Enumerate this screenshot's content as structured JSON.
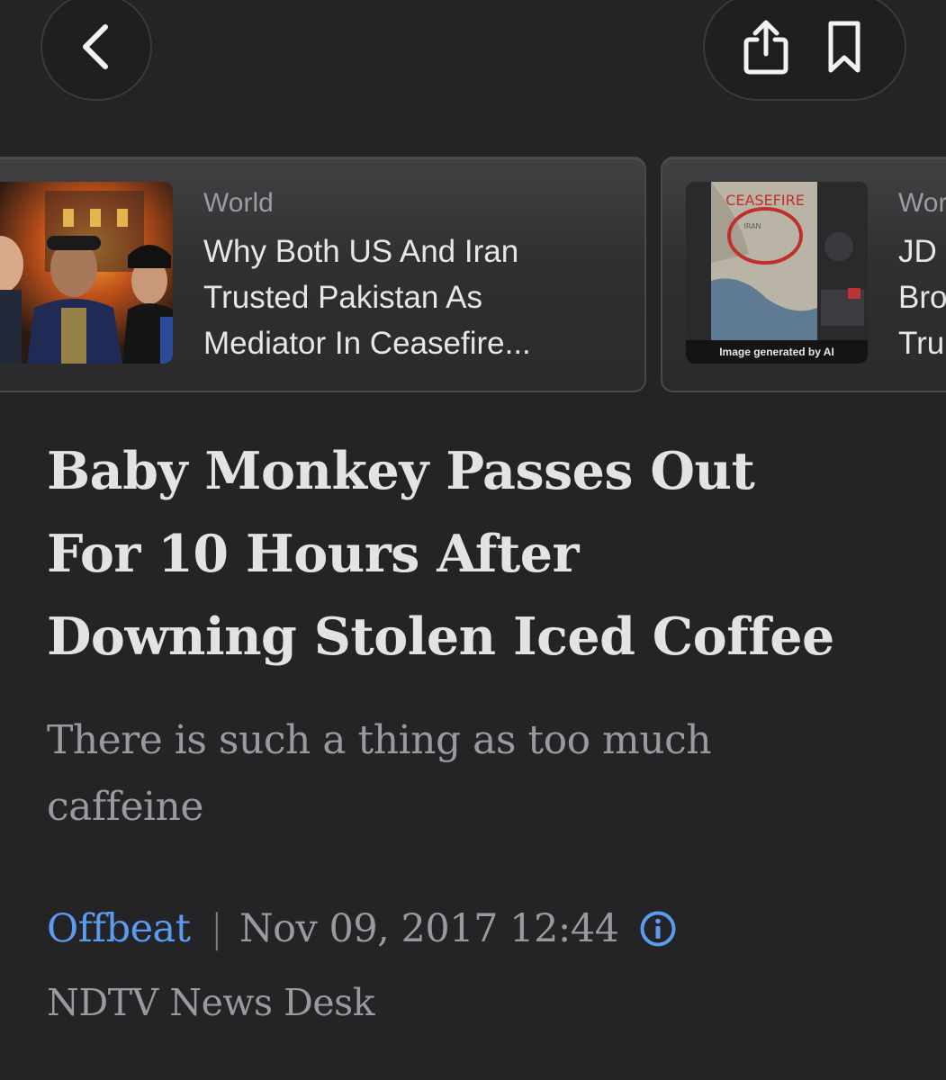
{
  "nav": {
    "back_icon": "chevron-left-icon",
    "share_icon": "share-icon",
    "bookmark_icon": "bookmark-icon"
  },
  "related": [
    {
      "category": "World",
      "title_lines": [
        "Why Both US And Iran",
        "Trusted Pakistan As",
        "Mediator In Ceasefire..."
      ]
    },
    {
      "category": "World",
      "title_lines": [
        "JD",
        "Bro",
        "Tru"
      ],
      "thumb_map_label": "CEASEFIRE",
      "thumb_map_sublabel": "IRAN",
      "thumb_caption": "Image generated by AI"
    }
  ],
  "article": {
    "headline_lines": [
      "Baby Monkey Passes Out",
      "For 10 Hours After",
      "Downing Stolen Iced Coffee"
    ],
    "subhead_lines": [
      "There is such a thing as too much",
      "caffeine"
    ],
    "category": "Offbeat",
    "separator": "|",
    "date": "Nov 09, 2017 12:44",
    "author": "NDTV News Desk"
  },
  "colors": {
    "background": "#242426",
    "link": "#5a9cf0",
    "headline": "#e3e3e5",
    "muted": "#9a9a9e"
  }
}
